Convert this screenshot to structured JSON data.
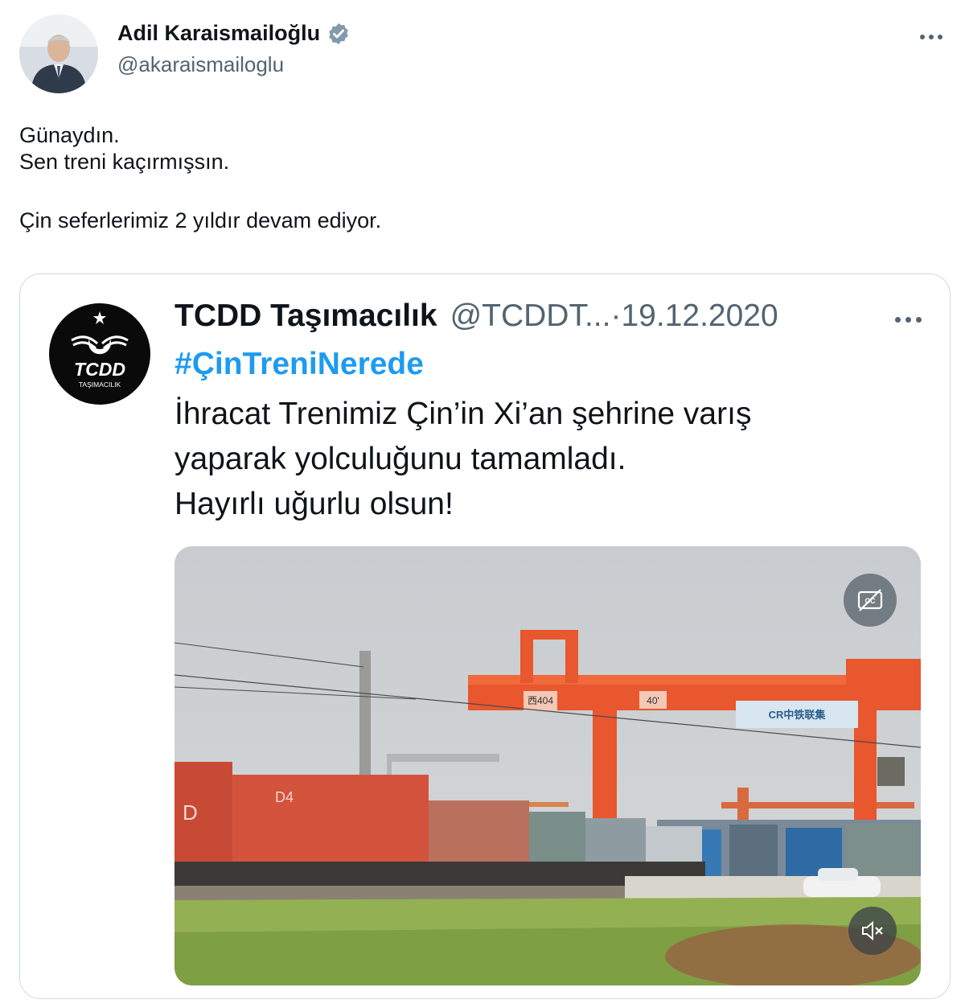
{
  "author": {
    "display_name": "Adil Karaismailoğlu",
    "handle": "@akaraismailoglu",
    "verified_icon": "verified-badge-icon",
    "verified_color": "#829aab"
  },
  "tweet": {
    "lines": [
      "Günaydın.",
      "Sen treni kaçırmışsın.",
      "Çin seferlerimiz 2 yıldır devam ediyor."
    ]
  },
  "quoted_tweet": {
    "logo_text": "TCDD",
    "logo_subtext": "TAŞIMACILIK",
    "display_name": "TCDD Taşımacılık",
    "handle": "@TCDDT...",
    "separator": "·",
    "date": "19.12.2020",
    "hashtag": "#ÇinTreniNerede",
    "hashtag_color": "#1d9bf0",
    "body_lines": [
      "İhracat Trenimiz Çin’in Xi’an şehrine varış",
      "yaparak yolculuğunu tamamladı.",
      "Hayırlı uğurlu olsun!"
    ],
    "media": {
      "crane_label": "西404",
      "crane_number": "40'",
      "crane_logo": "CR中铁联集",
      "container_label_1": "D",
      "container_label_2": "D4"
    }
  },
  "icons": {
    "more": "more-horizontal-icon",
    "captions": "captions-off-icon",
    "mute": "volume-muted-icon"
  }
}
